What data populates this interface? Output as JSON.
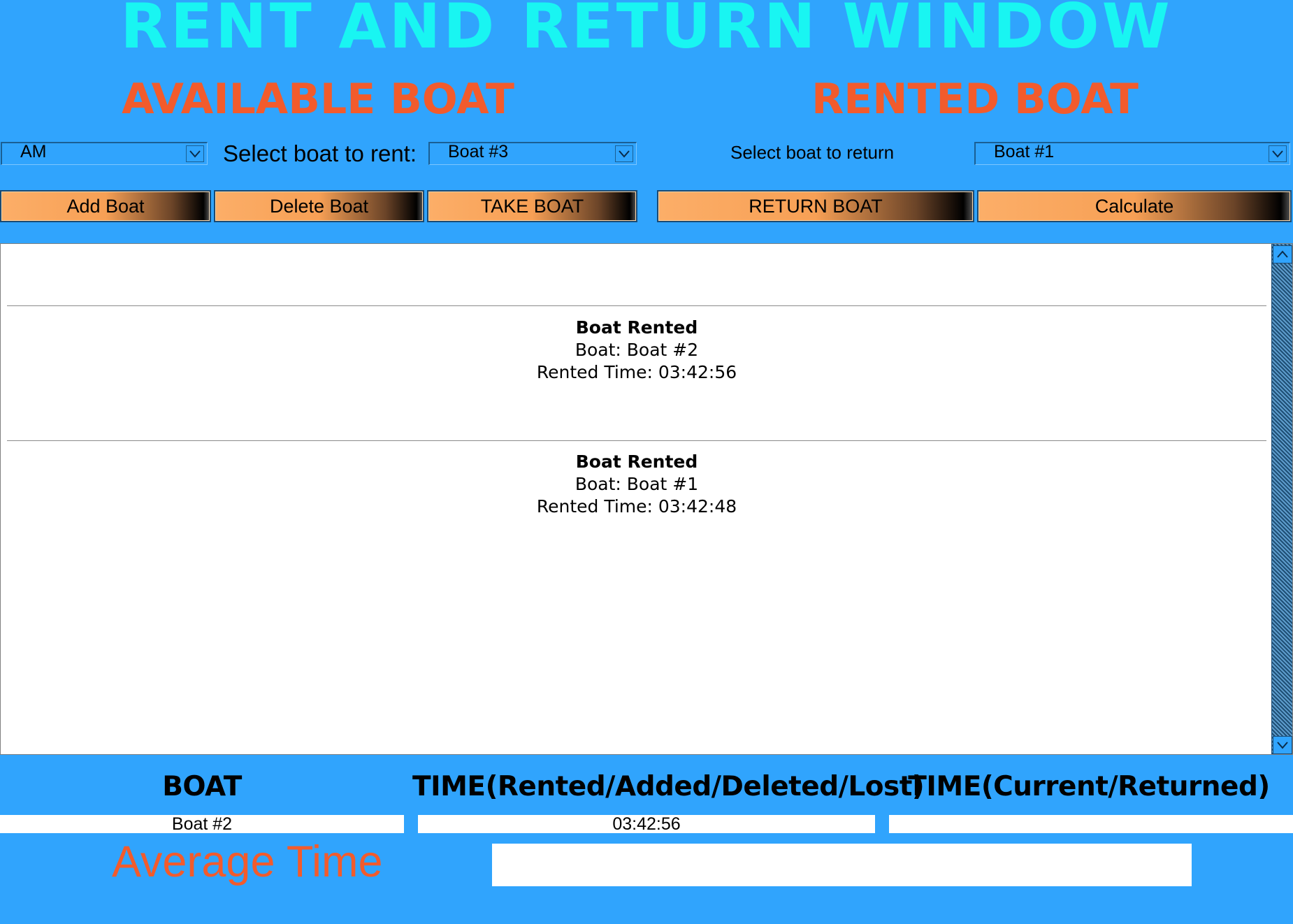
{
  "app": {
    "title": "RENT AND RETURN WINDOW"
  },
  "available": {
    "heading": "AVAILABLE BOAT",
    "period_select": "AM",
    "rent_label": "Select boat to rent:",
    "rent_select": "Boat #3",
    "buttons": {
      "add": "Add Boat",
      "delete": "Delete Boat",
      "take": "TAKE BOAT"
    }
  },
  "rented": {
    "heading": "RENTED BOAT",
    "return_label": "Select boat to return",
    "return_select": "Boat #1",
    "buttons": {
      "return": "RETURN  BOAT",
      "calculate": "Calculate"
    }
  },
  "log": {
    "entries": [
      {
        "title": "Boat Rented",
        "boat": "Boat: Boat #2",
        "time": "Rented Time: 03:42:56"
      },
      {
        "title": "Boat Rented",
        "boat": "Boat: Boat #1",
        "time": "Rented Time: 03:42:48"
      }
    ]
  },
  "table": {
    "headers": [
      "BOAT",
      "TIME(Rented/Added/Deleted/Lost)",
      "TIME(Current/Returned)"
    ],
    "row": [
      "Boat #2",
      "03:42:56",
      ""
    ]
  },
  "average": {
    "label": "Average Time",
    "value": ""
  },
  "icons": {
    "dropdown": "chevron-down-icon",
    "scroll_up": "chevron-up-icon",
    "scroll_down": "chevron-down-icon"
  },
  "colors": {
    "background": "#30a4fd",
    "title": "#19f5f2",
    "heading": "#f25b2c",
    "button_start": "#fcae68",
    "button_end": "#000000"
  }
}
